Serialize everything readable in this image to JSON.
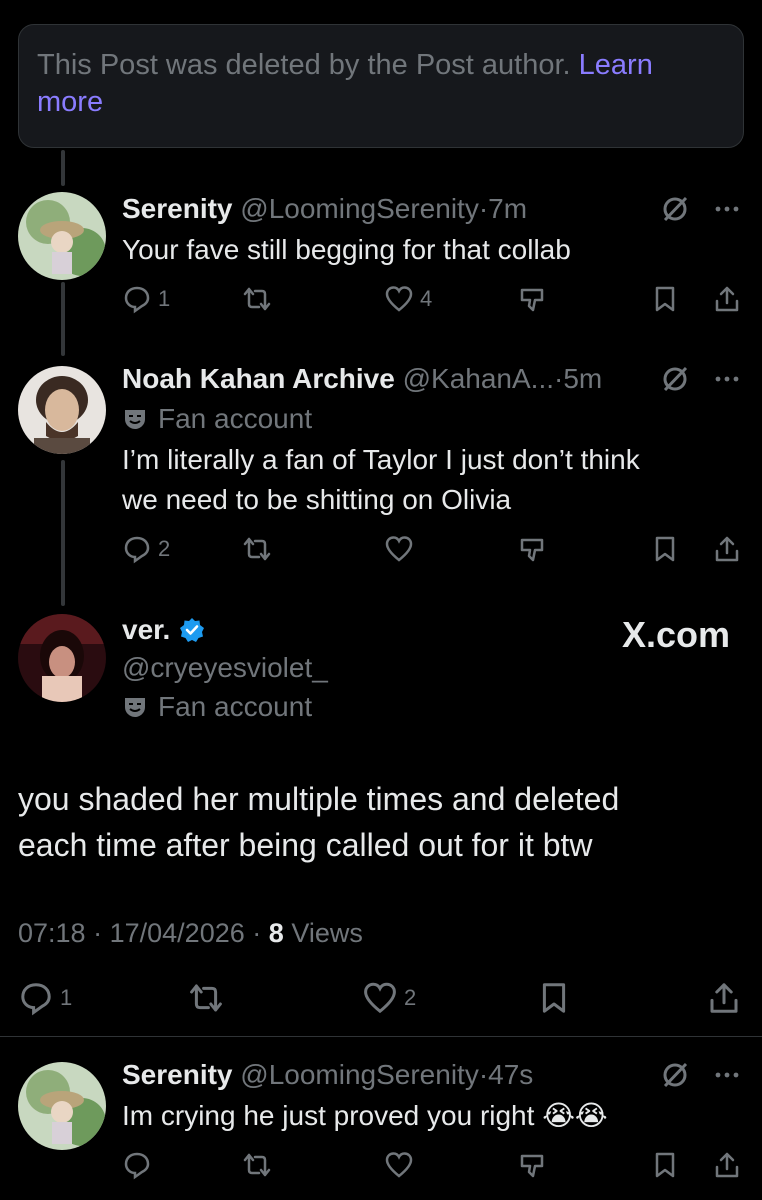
{
  "deleted_notice": {
    "text": "This Post was deleted by the Post author.",
    "link": "Learn",
    "link2": "more"
  },
  "replies": [
    {
      "name": "Serenity",
      "handle": "@LoomingSerenity",
      "time": "7m",
      "text": "Your fave still begging for that collab",
      "replies": "1",
      "likes": "4"
    },
    {
      "name": "Noah Kahan Archive",
      "handle": "@KahanA...",
      "time": "5m",
      "badge": "Fan account",
      "text_line1": "I’m literally a fan of Taylor I just don’t think",
      "text_line2": "we need to be shitting on Olivia",
      "replies": "2"
    },
    {
      "name": "Serenity",
      "handle": "@LoomingSerenity",
      "time": "47s",
      "text": "Im crying he just proved you right 😭😭"
    }
  ],
  "main_post": {
    "name": "ver.",
    "handle": "@cryeyesviolet_",
    "badge": "Fan account",
    "watermark": "X.com",
    "text_line1": "you shaded her multiple times and deleted",
    "text_line2": "each time after being called out for it btw",
    "time": "07:18",
    "date": "17/04/2026",
    "views_count": "8",
    "views_label": "Views",
    "replies": "1",
    "likes": "2"
  },
  "colors": {
    "background": "#000000",
    "muted": "#71767b",
    "link": "#8a7cff",
    "verified": "#1d9bf0"
  }
}
